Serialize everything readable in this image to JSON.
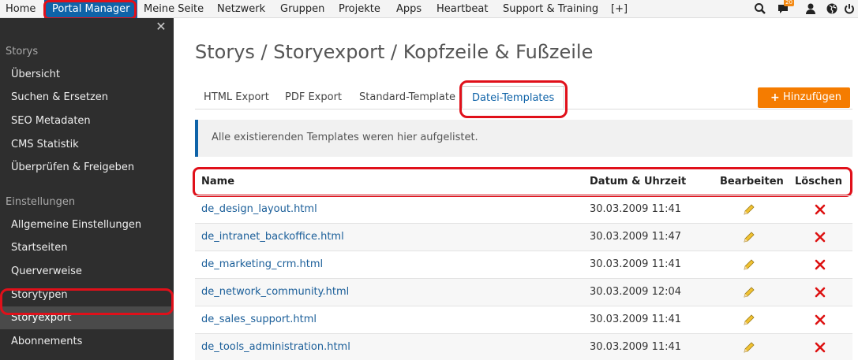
{
  "topnav": {
    "items": [
      {
        "label": "Home",
        "active": false
      },
      {
        "label": "Portal Manager",
        "active": true
      },
      {
        "label": "Meine Seite",
        "active": false
      },
      {
        "label": "Netzwerk",
        "active": false
      },
      {
        "label": "Gruppen",
        "active": false
      },
      {
        "label": "Projekte",
        "active": false
      },
      {
        "label": "Apps",
        "active": false
      },
      {
        "label": "Heartbeat",
        "active": false
      },
      {
        "label": "Support & Training",
        "active": false
      },
      {
        "label": "[+]",
        "active": false
      }
    ],
    "icons": [
      "search-icon",
      "messages-icon",
      "user-icon",
      "globe-icon",
      "power-icon"
    ],
    "message_count": "20"
  },
  "sidebar": {
    "section1": "Storys",
    "items1": [
      "Übersicht",
      "Suchen & Ersetzen",
      "SEO Metadaten",
      "CMS Statistik",
      "Überprüfen & Freigeben"
    ],
    "section2": "Einstellungen",
    "items2": [
      "Allgemeine Einstellungen",
      "Startseiten",
      "Querverweise",
      "Storytypen",
      "Storyexport",
      "Abonnements"
    ],
    "active": "Storyexport"
  },
  "main": {
    "title": "Storys / Storyexport / Kopfzeile & Fußzeile",
    "tabs": [
      {
        "label": "HTML Export",
        "active": false
      },
      {
        "label": "PDF Export",
        "active": false
      },
      {
        "label": "Standard-Template",
        "active": false
      },
      {
        "label": "Datei-Templates",
        "active": true
      }
    ],
    "add_button": "Hinzufügen",
    "info": "Alle existierenden Templates weren hier aufgelistet.",
    "table": {
      "headers": [
        "Name",
        "Datum & Uhrzeit",
        "Bearbeiten",
        "Löschen"
      ],
      "rows": [
        {
          "name": "de_design_layout.html",
          "date": "30.03.2009 11:41"
        },
        {
          "name": "de_intranet_backoffice.html",
          "date": "30.03.2009 11:47"
        },
        {
          "name": "de_marketing_crm.html",
          "date": "30.03.2009 11:41"
        },
        {
          "name": "de_network_community.html",
          "date": "30.03.2009 12:04"
        },
        {
          "name": "de_sales_support.html",
          "date": "30.03.2009 11:41"
        },
        {
          "name": "de_tools_administration.html",
          "date": "30.03.2009 11:41"
        }
      ]
    }
  },
  "colors": {
    "accent": "#0f63a8",
    "highlight": "#e0101a",
    "button": "#f57c00",
    "sidebar_bg": "#2e2e2e"
  }
}
